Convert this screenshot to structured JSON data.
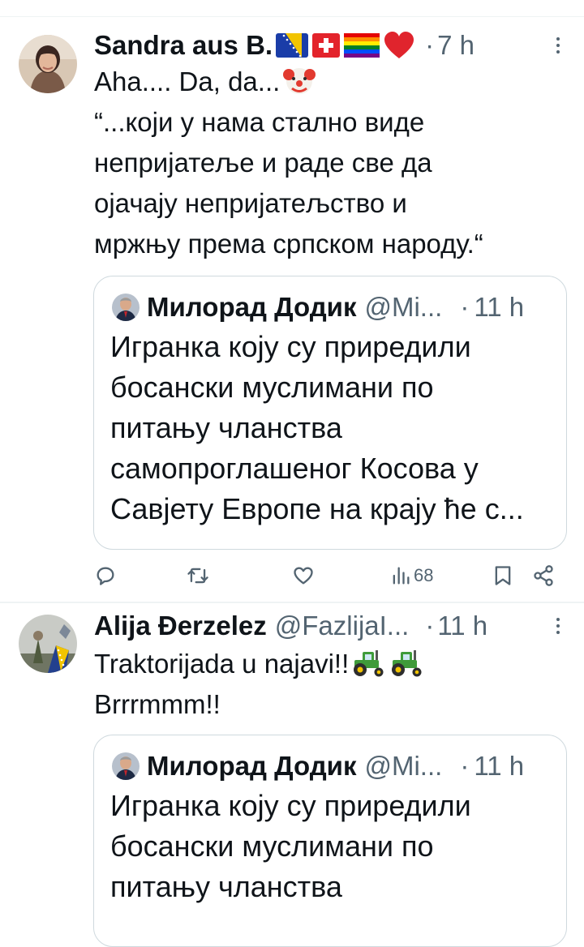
{
  "tweets": [
    {
      "display_name": "Sandra aus B.",
      "name_emojis": [
        "flag-bosnia-icon",
        "flag-switzerland-icon",
        "rainbow-flag-icon",
        "red-heart-icon"
      ],
      "dot": "·",
      "time": "7 h",
      "text_lines": [
        "Aha.... Da, da...",
        "“...који у нама стално виде",
        "непријатеље и раде све да",
        "ојачају непријатељство и",
        "мржњу према српском народу.“"
      ],
      "text_emoji": "clown-face-icon",
      "quote": {
        "name": "Милорад Додик",
        "handle": "@Mi...",
        "dot": "·",
        "time": "11 h",
        "text_lines": [
          "Игранка коју су приредили",
          "босански муслимани по",
          "питању чланства",
          "самопроглашеног Косова у",
          "Савјету Европе на крају ће с..."
        ]
      },
      "actions": {
        "reply_icon": "reply-icon",
        "retweet_icon": "retweet-icon",
        "like_icon": "heart-icon",
        "views_icon": "views-icon",
        "views_count": "68",
        "bookmark_icon": "bookmark-icon",
        "share_icon": "share-icon"
      }
    },
    {
      "display_name": "Alija Đerzelez",
      "handle": "@FazlijaI...",
      "dot": "·",
      "time": "11 h",
      "text_lines": [
        "Traktorijada u najavi!!",
        "Brrrmmm!!"
      ],
      "text_emojis": [
        "tractor-icon",
        "tractor-icon"
      ],
      "quote": {
        "name": "Милорад Додик",
        "handle": "@Mi...",
        "dot": "·",
        "time": "11 h",
        "text_lines": [
          "Игранка коју су приредили",
          "босански муслимани по",
          "питању чланства"
        ]
      }
    }
  ],
  "colors": {
    "text_primary": "#0f1419",
    "text_secondary": "#536471",
    "border": "#cfd9de",
    "divider": "#eff3f4"
  }
}
